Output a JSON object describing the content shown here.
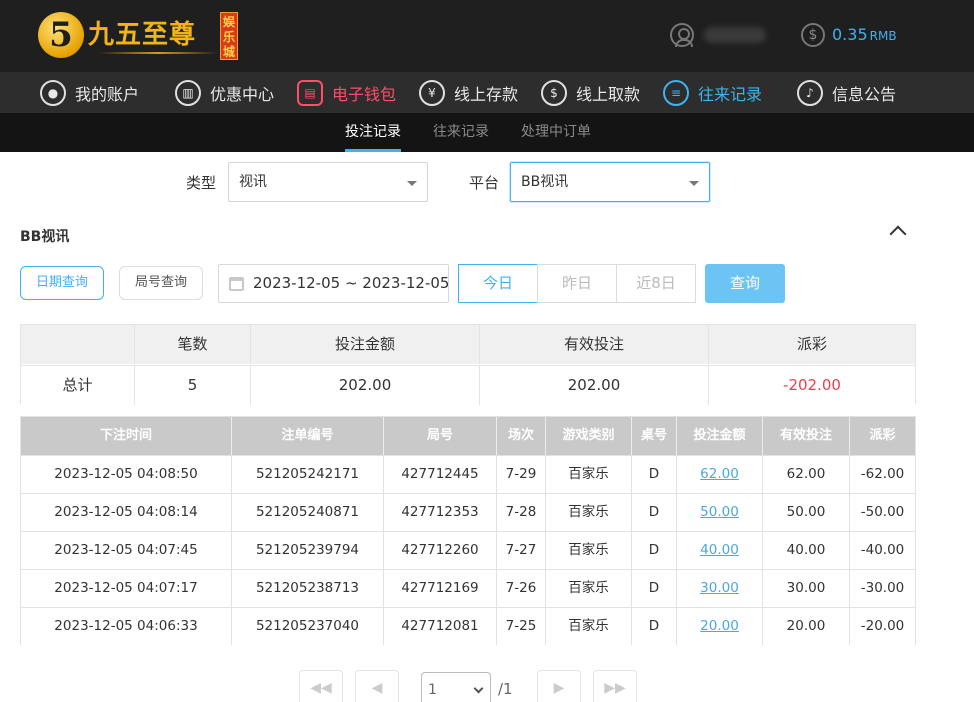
{
  "header": {
    "logo_digit": "5",
    "logo_text": "九五至尊",
    "logo_badge": "娱乐城",
    "balance": "0.35",
    "currency": "RMB",
    "balance_color": "#3fb2f0"
  },
  "nav": [
    {
      "label": "我的账户",
      "icon": "user-circle-icon"
    },
    {
      "label": "优惠中心",
      "icon": "gift-icon"
    },
    {
      "label": "电子钱包",
      "icon": "wallet-icon",
      "state": "highlight-red"
    },
    {
      "label": "线上存款",
      "icon": "deposit-icon"
    },
    {
      "label": "线上取款",
      "icon": "withdraw-icon"
    },
    {
      "label": "往来记录",
      "icon": "records-icon",
      "state": "active"
    },
    {
      "label": "信息公告",
      "icon": "bell-icon"
    }
  ],
  "subnav": [
    {
      "label": "投注记录",
      "active": true
    },
    {
      "label": "往来记录"
    },
    {
      "label": "处理中订单"
    }
  ],
  "filters": {
    "type_label": "类型",
    "type_value": "视讯",
    "platform_label": "平台",
    "platform_value": "BB视讯"
  },
  "section": {
    "title": "BB视讯",
    "date_query": "日期查询",
    "round_query": "局号查询",
    "date_range": "2023-12-05 ~ 2023-12-05",
    "today": "今日",
    "yesterday": "昨日",
    "last8": "近8日",
    "query": "查询"
  },
  "summary": {
    "headers": [
      "",
      "笔数",
      "投注金额",
      "有效投注",
      "派彩"
    ],
    "row": [
      "总计",
      "5",
      "202.00",
      "202.00",
      "-202.00"
    ]
  },
  "details": {
    "headers": [
      "下注时间",
      "注单编号",
      "局号",
      "场次",
      "游戏类别",
      "桌号",
      "投注金额",
      "有效投注",
      "派彩"
    ],
    "rows": [
      [
        "2023-12-05 04:08:50",
        "521205242171",
        "427712445",
        "7-29",
        "百家乐",
        "D",
        "62.00",
        "62.00",
        "-62.00"
      ],
      [
        "2023-12-05 04:08:14",
        "521205240871",
        "427712353",
        "7-28",
        "百家乐",
        "D",
        "50.00",
        "50.00",
        "-50.00"
      ],
      [
        "2023-12-05 04:07:45",
        "521205239794",
        "427712260",
        "7-27",
        "百家乐",
        "D",
        "40.00",
        "40.00",
        "-40.00"
      ],
      [
        "2023-12-05 04:07:17",
        "521205238713",
        "427712169",
        "7-26",
        "百家乐",
        "D",
        "30.00",
        "30.00",
        "-30.00"
      ],
      [
        "2023-12-05 04:06:33",
        "521205237040",
        "427712081",
        "7-25",
        "百家乐",
        "D",
        "20.00",
        "20.00",
        "-20.00"
      ]
    ]
  },
  "pagination": {
    "first": "◀◀",
    "prev": "◀",
    "current": "1",
    "total": "/1",
    "next": "▶",
    "last": "▶▶"
  }
}
